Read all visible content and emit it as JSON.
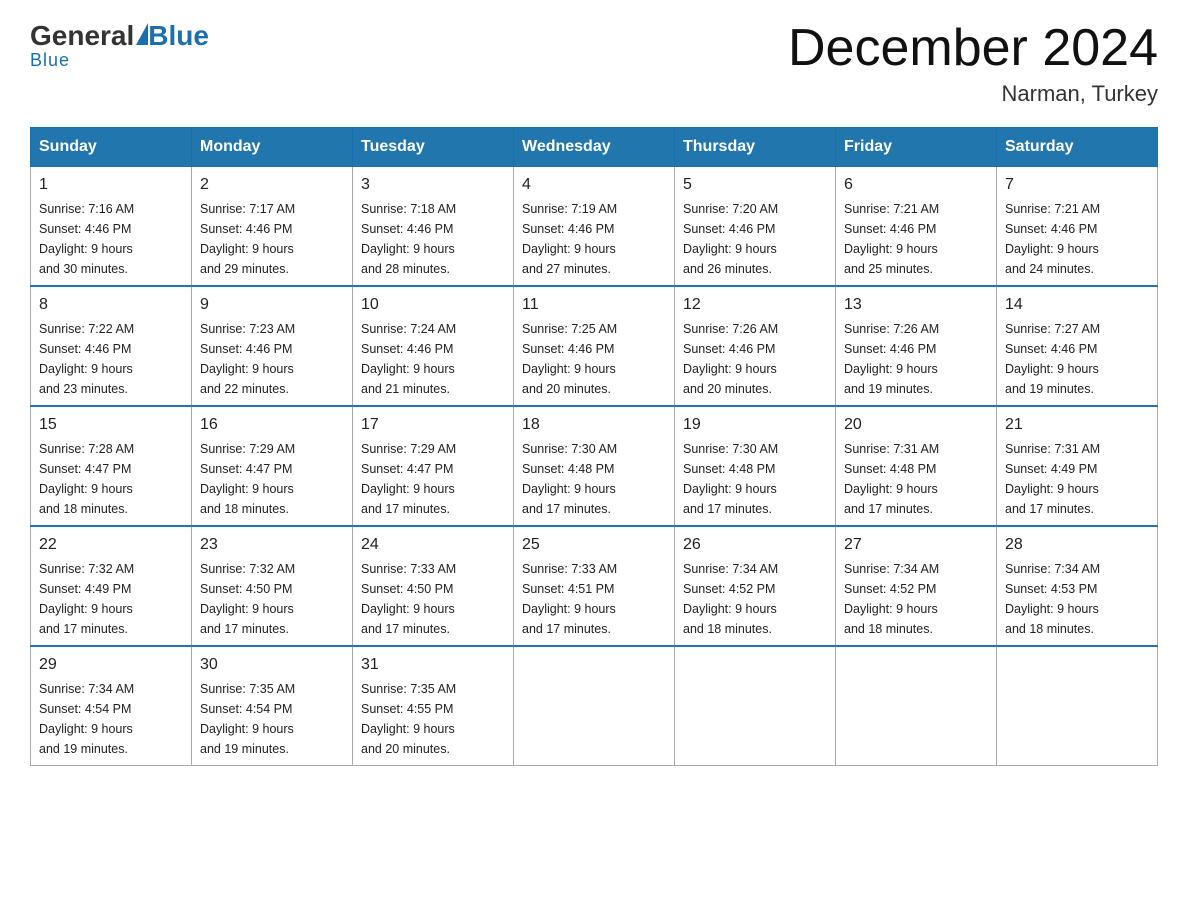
{
  "logo": {
    "general": "General",
    "blue": "Blue"
  },
  "title": {
    "month_year": "December 2024",
    "location": "Narman, Turkey"
  },
  "days_header": [
    "Sunday",
    "Monday",
    "Tuesday",
    "Wednesday",
    "Thursday",
    "Friday",
    "Saturday"
  ],
  "weeks": [
    [
      {
        "day": "1",
        "sunrise": "7:16 AM",
        "sunset": "4:46 PM",
        "daylight": "9 hours and 30 minutes."
      },
      {
        "day": "2",
        "sunrise": "7:17 AM",
        "sunset": "4:46 PM",
        "daylight": "9 hours and 29 minutes."
      },
      {
        "day": "3",
        "sunrise": "7:18 AM",
        "sunset": "4:46 PM",
        "daylight": "9 hours and 28 minutes."
      },
      {
        "day": "4",
        "sunrise": "7:19 AM",
        "sunset": "4:46 PM",
        "daylight": "9 hours and 27 minutes."
      },
      {
        "day": "5",
        "sunrise": "7:20 AM",
        "sunset": "4:46 PM",
        "daylight": "9 hours and 26 minutes."
      },
      {
        "day": "6",
        "sunrise": "7:21 AM",
        "sunset": "4:46 PM",
        "daylight": "9 hours and 25 minutes."
      },
      {
        "day": "7",
        "sunrise": "7:21 AM",
        "sunset": "4:46 PM",
        "daylight": "9 hours and 24 minutes."
      }
    ],
    [
      {
        "day": "8",
        "sunrise": "7:22 AM",
        "sunset": "4:46 PM",
        "daylight": "9 hours and 23 minutes."
      },
      {
        "day": "9",
        "sunrise": "7:23 AM",
        "sunset": "4:46 PM",
        "daylight": "9 hours and 22 minutes."
      },
      {
        "day": "10",
        "sunrise": "7:24 AM",
        "sunset": "4:46 PM",
        "daylight": "9 hours and 21 minutes."
      },
      {
        "day": "11",
        "sunrise": "7:25 AM",
        "sunset": "4:46 PM",
        "daylight": "9 hours and 20 minutes."
      },
      {
        "day": "12",
        "sunrise": "7:26 AM",
        "sunset": "4:46 PM",
        "daylight": "9 hours and 20 minutes."
      },
      {
        "day": "13",
        "sunrise": "7:26 AM",
        "sunset": "4:46 PM",
        "daylight": "9 hours and 19 minutes."
      },
      {
        "day": "14",
        "sunrise": "7:27 AM",
        "sunset": "4:46 PM",
        "daylight": "9 hours and 19 minutes."
      }
    ],
    [
      {
        "day": "15",
        "sunrise": "7:28 AM",
        "sunset": "4:47 PM",
        "daylight": "9 hours and 18 minutes."
      },
      {
        "day": "16",
        "sunrise": "7:29 AM",
        "sunset": "4:47 PM",
        "daylight": "9 hours and 18 minutes."
      },
      {
        "day": "17",
        "sunrise": "7:29 AM",
        "sunset": "4:47 PM",
        "daylight": "9 hours and 17 minutes."
      },
      {
        "day": "18",
        "sunrise": "7:30 AM",
        "sunset": "4:48 PM",
        "daylight": "9 hours and 17 minutes."
      },
      {
        "day": "19",
        "sunrise": "7:30 AM",
        "sunset": "4:48 PM",
        "daylight": "9 hours and 17 minutes."
      },
      {
        "day": "20",
        "sunrise": "7:31 AM",
        "sunset": "4:48 PM",
        "daylight": "9 hours and 17 minutes."
      },
      {
        "day": "21",
        "sunrise": "7:31 AM",
        "sunset": "4:49 PM",
        "daylight": "9 hours and 17 minutes."
      }
    ],
    [
      {
        "day": "22",
        "sunrise": "7:32 AM",
        "sunset": "4:49 PM",
        "daylight": "9 hours and 17 minutes."
      },
      {
        "day": "23",
        "sunrise": "7:32 AM",
        "sunset": "4:50 PM",
        "daylight": "9 hours and 17 minutes."
      },
      {
        "day": "24",
        "sunrise": "7:33 AM",
        "sunset": "4:50 PM",
        "daylight": "9 hours and 17 minutes."
      },
      {
        "day": "25",
        "sunrise": "7:33 AM",
        "sunset": "4:51 PM",
        "daylight": "9 hours and 17 minutes."
      },
      {
        "day": "26",
        "sunrise": "7:34 AM",
        "sunset": "4:52 PM",
        "daylight": "9 hours and 18 minutes."
      },
      {
        "day": "27",
        "sunrise": "7:34 AM",
        "sunset": "4:52 PM",
        "daylight": "9 hours and 18 minutes."
      },
      {
        "day": "28",
        "sunrise": "7:34 AM",
        "sunset": "4:53 PM",
        "daylight": "9 hours and 18 minutes."
      }
    ],
    [
      {
        "day": "29",
        "sunrise": "7:34 AM",
        "sunset": "4:54 PM",
        "daylight": "9 hours and 19 minutes."
      },
      {
        "day": "30",
        "sunrise": "7:35 AM",
        "sunset": "4:54 PM",
        "daylight": "9 hours and 19 minutes."
      },
      {
        "day": "31",
        "sunrise": "7:35 AM",
        "sunset": "4:55 PM",
        "daylight": "9 hours and 20 minutes."
      },
      null,
      null,
      null,
      null
    ]
  ],
  "labels": {
    "sunrise": "Sunrise:",
    "sunset": "Sunset:",
    "daylight": "Daylight:"
  }
}
